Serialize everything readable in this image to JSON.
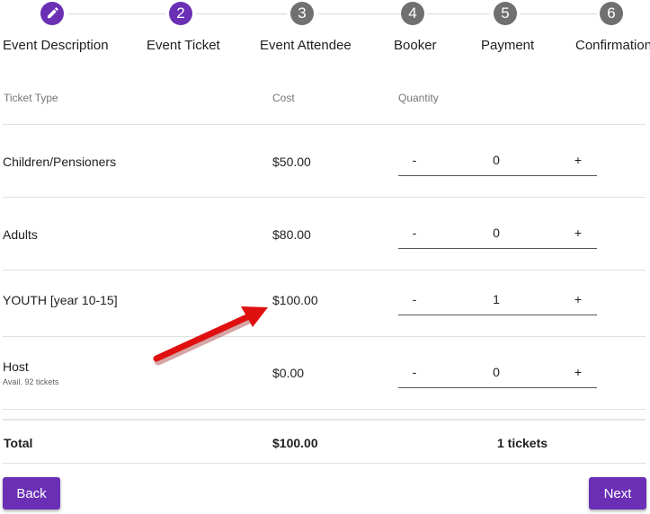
{
  "stepper": {
    "steps": [
      {
        "label": "Event Description",
        "number": "",
        "icon": "pencil-icon",
        "state": "done"
      },
      {
        "label": "Event Ticket",
        "number": "2",
        "state": "active"
      },
      {
        "label": "Event Attendee",
        "number": "3",
        "state": "inactive"
      },
      {
        "label": "Booker",
        "number": "4",
        "state": "inactive"
      },
      {
        "label": "Payment",
        "number": "5",
        "state": "inactive"
      },
      {
        "label": "Confirmation",
        "number": "6",
        "state": "inactive"
      }
    ]
  },
  "table": {
    "headers": {
      "type": "Ticket Type",
      "cost": "Cost",
      "quantity": "Quantity"
    },
    "rows": [
      {
        "type": "Children/Pensioners",
        "note": "",
        "cost": "$50.00",
        "quantity": "0",
        "minus": "-",
        "plus": "+"
      },
      {
        "type": "Adults",
        "note": "",
        "cost": "$80.00",
        "quantity": "0",
        "minus": "-",
        "plus": "+"
      },
      {
        "type": "YOUTH [year 10-15]",
        "note": "",
        "cost": "$100.00",
        "quantity": "1",
        "minus": "-",
        "plus": "+"
      },
      {
        "type": "Host",
        "note": "Avail. 92 tickets",
        "cost": "$0.00",
        "quantity": "0",
        "minus": "-",
        "plus": "+"
      }
    ],
    "total": {
      "label": "Total",
      "cost": "$100.00",
      "tickets": "1 tickets"
    }
  },
  "actions": {
    "back": "Back",
    "next": "Next"
  },
  "colors": {
    "accent": "#6a2fb5",
    "inactive": "#707070",
    "annotation_arrow": "#e01010"
  }
}
